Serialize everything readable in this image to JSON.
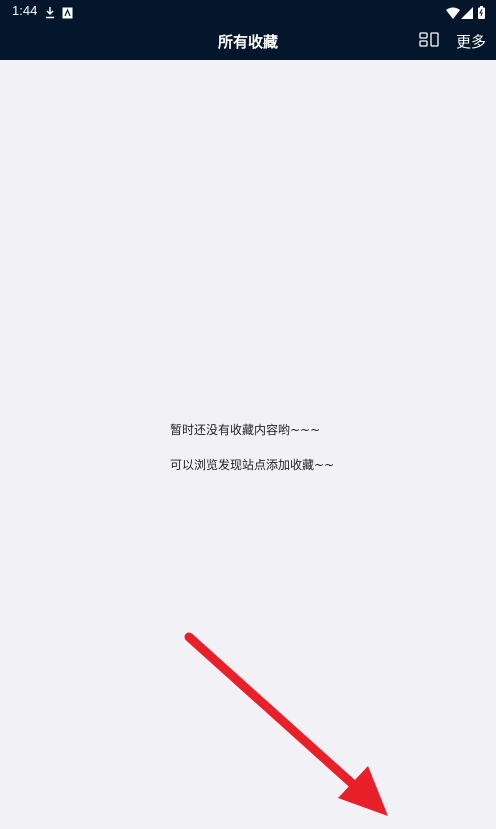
{
  "status_bar": {
    "time": "1:44",
    "icons": [
      "download-icon",
      "app-notification-icon",
      "wifi-icon",
      "signal-icon",
      "battery-icon"
    ]
  },
  "app_bar": {
    "title": "所有收藏",
    "layout_icon": "grid-layout-icon",
    "more_label": "更多",
    "background": "#03162b"
  },
  "empty_state": {
    "line1": "暂时还没有收藏内容哟~~~",
    "line2": "可以浏览发现站点添加收藏~~"
  },
  "annotation": {
    "icon": "red-arrow-icon",
    "color": "#e8202a"
  }
}
